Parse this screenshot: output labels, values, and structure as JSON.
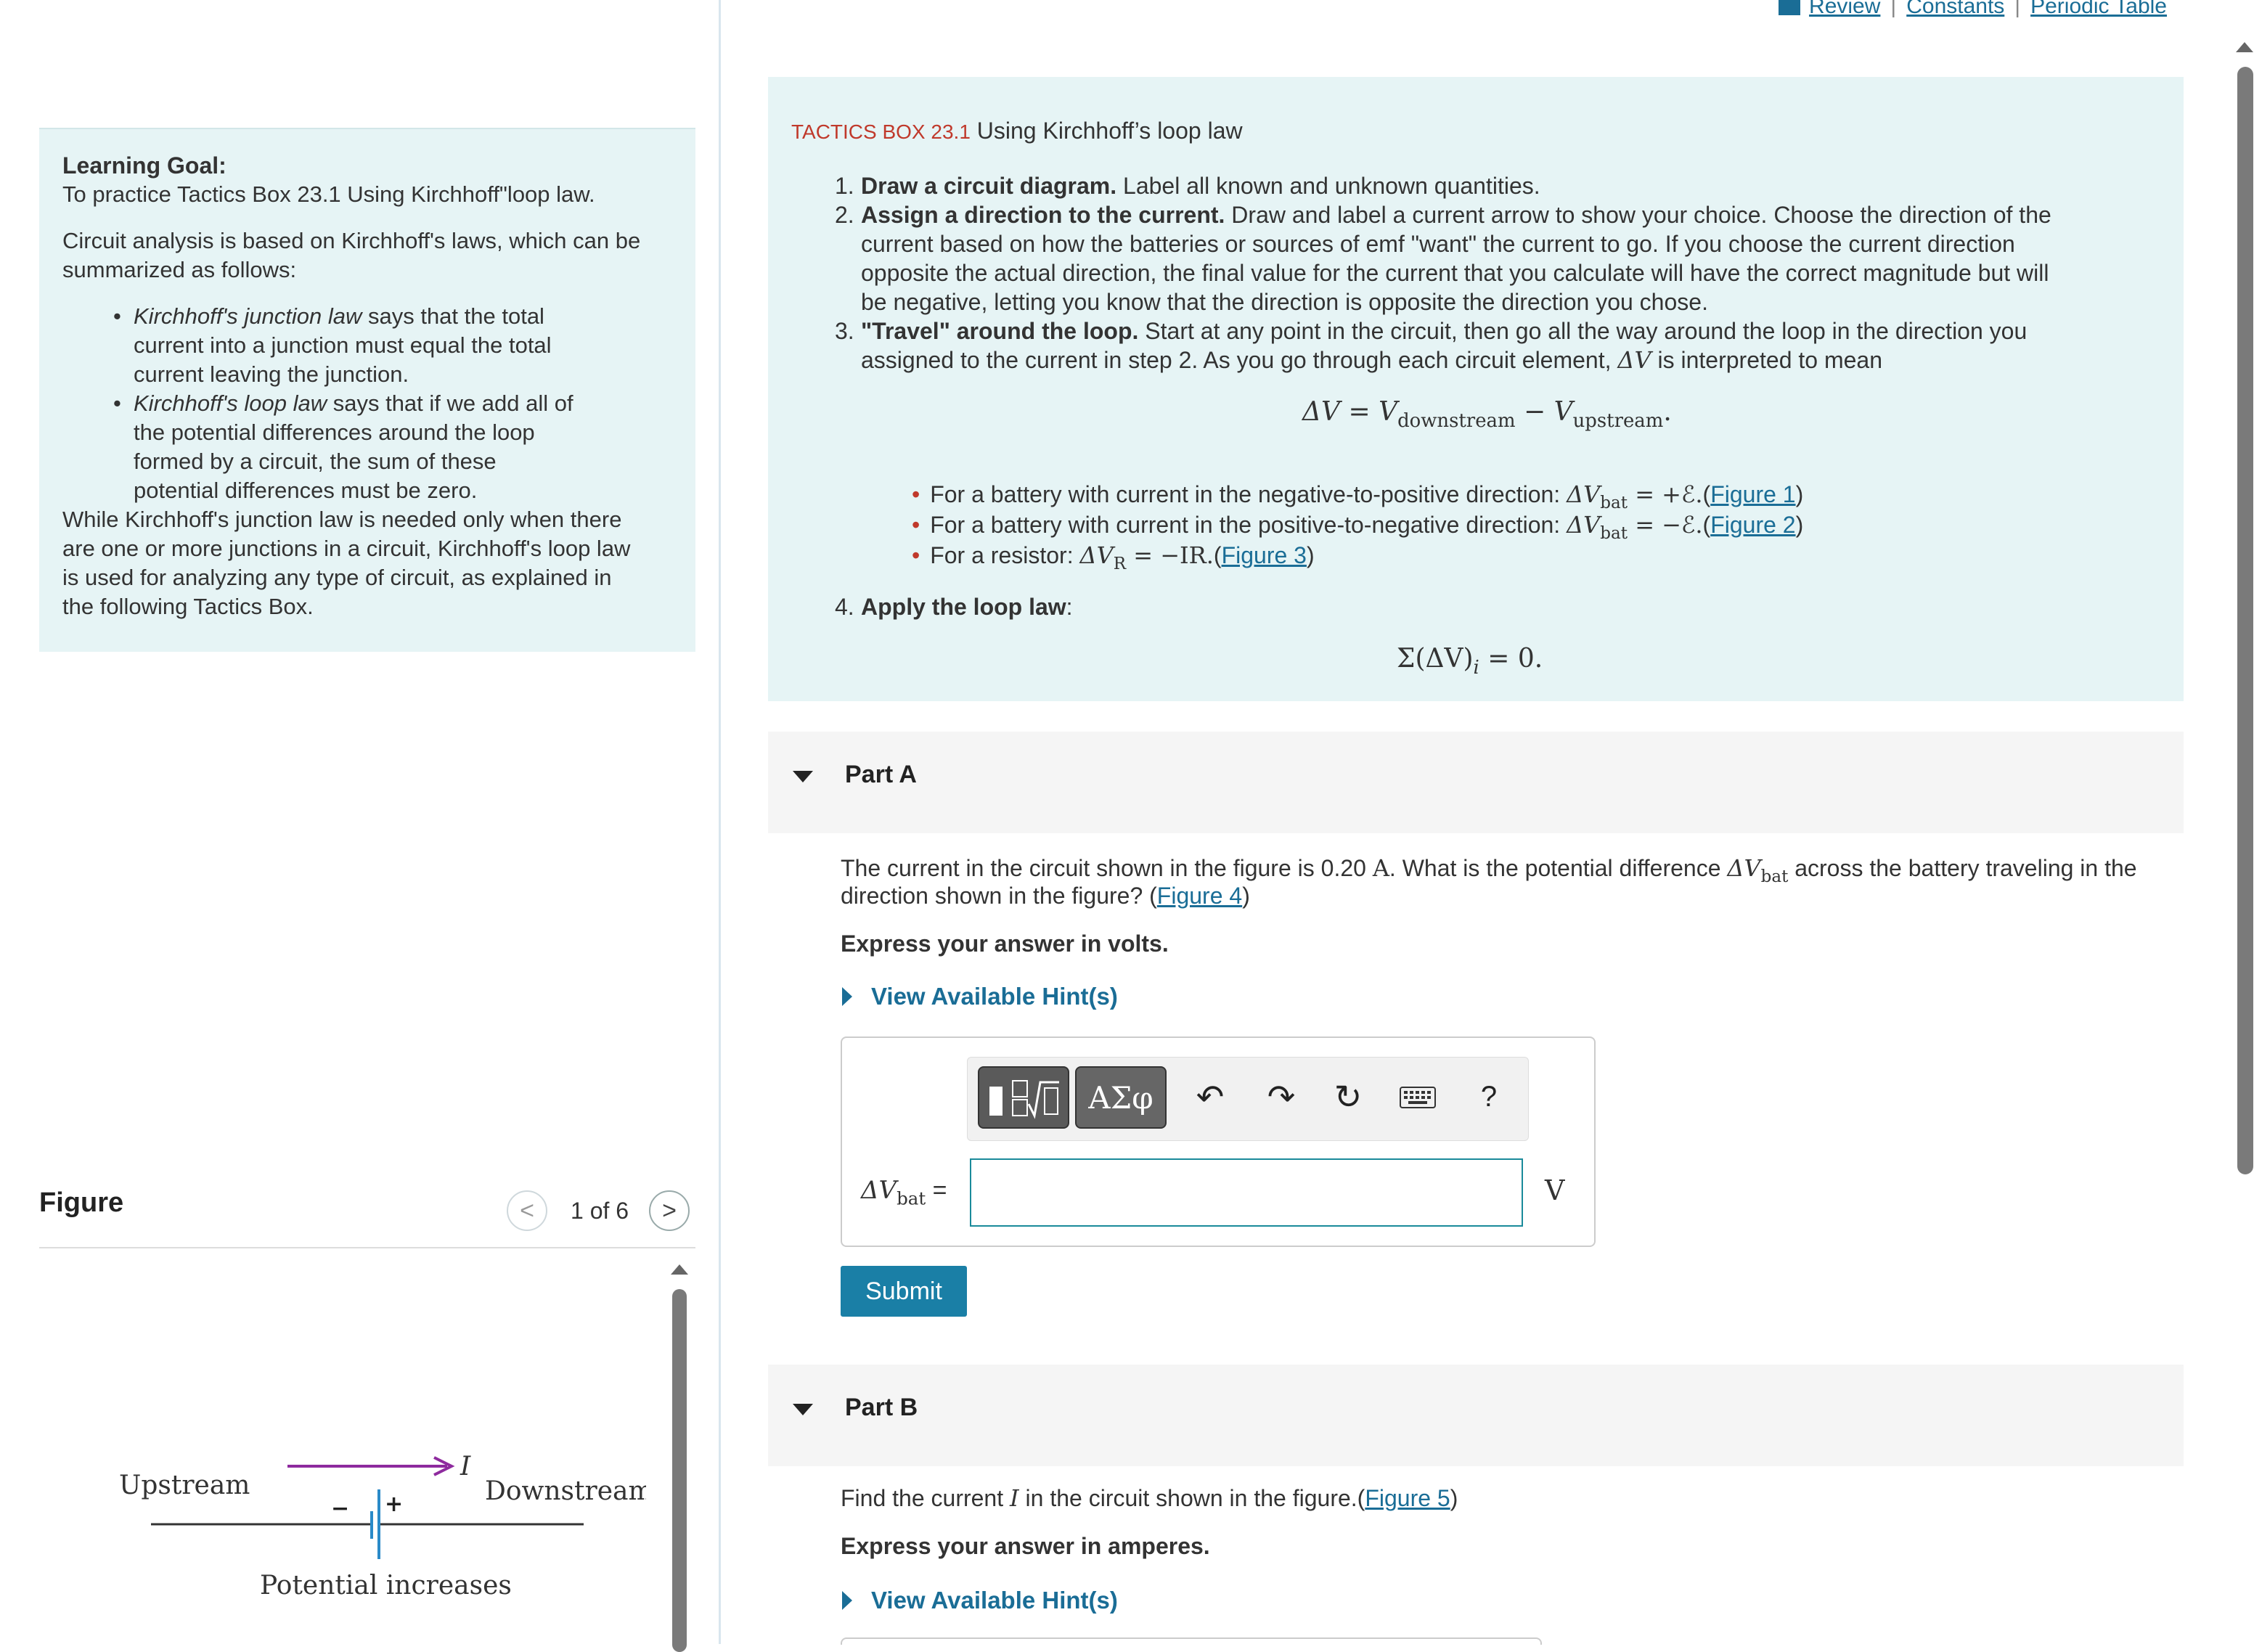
{
  "top_links": {
    "review": "Review",
    "constants": "Constants",
    "periodic_table": "Periodic Table",
    "separator": "|"
  },
  "learning_goal": {
    "heading": "Learning Goal:",
    "goal_text": "To practice Tactics Box 23.1 Using Kirchhoff\"loop law.",
    "intro": [
      "Circuit analysis is based on Kirchhoff's laws, which can be",
      "summarized as follows:"
    ],
    "bullets": [
      {
        "term": "Kirchhoff's junction law",
        "lines": [
          " says that the total",
          "current into a junction must equal the total",
          "current leaving the junction."
        ]
      },
      {
        "term": "Kirchhoff's loop law",
        "lines": [
          " says that if we add all of",
          "the potential differences around the loop",
          "formed by a circuit, the sum of these",
          "potential differences must be zero."
        ]
      }
    ],
    "closing": [
      "While Kirchhoff's junction law is needed only when there",
      "are one or more junctions in a circuit, Kirchhoff's loop law",
      "is used for analyzing any type of circuit, as explained in",
      "the following Tactics Box."
    ]
  },
  "figure_panel": {
    "title": "Figure",
    "counter": "1 of 6",
    "prev_symbol": "<",
    "next_symbol": ">",
    "labels": {
      "upstream": "Upstream",
      "downstream": "Downstream",
      "current": "I",
      "potential": "Potential increases",
      "minus": "−",
      "plus": "+"
    }
  },
  "tactics": {
    "label": "TACTICS BOX 23.1",
    "title": "Using Kirchhoff’s loop law",
    "step1_num": "1.",
    "step1_bold": "Draw a circuit diagram.",
    "step1_text": " Label all known and unknown quantities.",
    "step2_num": "2.",
    "step2_bold": "Assign a direction to the current.",
    "step2_lines": [
      " Draw and label a current arrow to show your choice. Choose the direction of the",
      "current based on how the batteries or sources of emf \"want\" the current to go. If you choose the current direction",
      "opposite the actual direction, the final value for the current that you calculate will have the correct magnitude but will",
      "be negative, letting you know that the direction is opposite the direction you chose."
    ],
    "step3_num": "3.",
    "step3_bold": "\"Travel\" around the loop.",
    "step3_lines": [
      " Start at any point in the circuit, then go all the way around the loop in the direction you",
      "assigned to the current in step 2. As you go through each circuit element, ",
      " is interpreted to mean"
    ],
    "eq_dv": "ΔV",
    "eq_main": {
      "lhs": "ΔV",
      "equals": " = ",
      "v": "V",
      "down": "downstream",
      "minus": " − ",
      "up": "upstream",
      "end": "."
    },
    "rules": [
      {
        "text": "For a battery with current in the negative-to-positive direction: ",
        "math": "ΔV",
        "sub": "bat",
        "rhs": " = +ℰ.",
        "link": "Figure 1"
      },
      {
        "text": "For a battery with current in the positive-to-negative direction: ",
        "math": "ΔV",
        "sub": "bat",
        "rhs": " = −ℰ.",
        "link": "Figure 2"
      },
      {
        "text": "For a resistor: ",
        "math": "ΔV",
        "sub": "R",
        "rhs": " = −IR.",
        "link": "Figure 3"
      }
    ],
    "step4_num": "4.",
    "step4_bold": "Apply the loop law",
    "step4_text": ":",
    "loop_eq": "Σ(ΔV)",
    "loop_sub": "i",
    "loop_rhs": " = 0."
  },
  "part_a": {
    "title": "Part A",
    "q_line1_a": "The current in the circuit shown in the figure is 0.20 ",
    "q_unit": "A",
    "q_line1_b": ". What is the potential difference ",
    "q_sym": "ΔV",
    "q_sub": "bat",
    "q_line1_c": " across the battery traveling in the",
    "q_line2_a": "direction shown in the figure? (",
    "q_link": "Figure 4",
    "q_line2_b": ")",
    "instruction": "Express your answer in volts.",
    "hint_label": "View Available Hint(s)",
    "toolbar": {
      "templates_icon": "templates-icon",
      "symbols_label": "ΑΣφ",
      "undo": "↶",
      "redo": "↷",
      "reset": "↻",
      "keyboard": "keyboard-icon",
      "help": "?"
    },
    "answer_label_sym": "ΔV",
    "answer_label_sub": "bat",
    "answer_label_eq": " =",
    "answer_value": "",
    "unit": "V",
    "submit": "Submit"
  },
  "part_b": {
    "title": "Part B",
    "q_a": "Find the current ",
    "q_sym": "I",
    "q_b": " in the circuit shown in the figure.(",
    "q_link": "Figure 5",
    "q_c": ")",
    "instruction": "Express your answer in amperes.",
    "hint_label": "View Available Hint(s)"
  },
  "colors": {
    "accent": "#1a6d96",
    "panel_bg": "#e6f4f5",
    "tactics_label": "#c0392b",
    "submit_bg": "#1a7fa6",
    "figure_arrow": "#8e2a9e",
    "figure_battery": "#2a8ac8"
  }
}
